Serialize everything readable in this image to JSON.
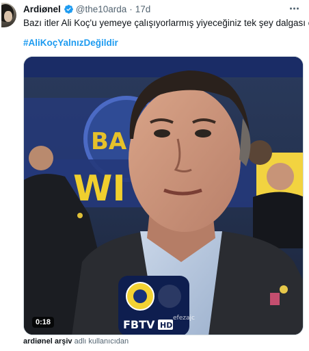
{
  "author": {
    "display_name": "Ardiønel",
    "handle": "@the10arda",
    "separator": "·",
    "timestamp": "17d",
    "verified": true,
    "avatar_icon": "user-avatar"
  },
  "tweet": {
    "text": "Bazı itler Ali Koç'u yemeye çalışıyorlarmış yiyeceğiniz tek şey dalgası olur",
    "hashtag": "#AliKoçYalnızDeğildir"
  },
  "media": {
    "type": "video",
    "duration": "0:18",
    "mic_brand": "FBTV",
    "mic_tag": "HD",
    "watermark": "efezajc",
    "banner_text": "BA",
    "banner_text_2": "WI"
  },
  "attribution": {
    "source": "ardiønel arşiv",
    "suffix": " adlı kullanıcıdan"
  },
  "colors": {
    "link": "#1d9bf0",
    "verified": "#1d9bf0",
    "secondary_text": "#536471",
    "primary_text": "#0f1419"
  }
}
